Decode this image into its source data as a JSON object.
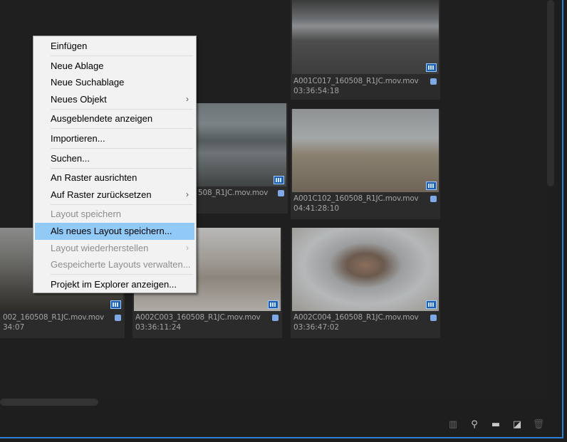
{
  "clips": [
    {
      "name": "A001C017_160508_R1JC.mov.mov",
      "timecode": "03:36:54:18"
    },
    {
      "name": "A001C102_160508_R1JC.mov.mov",
      "timecode": "04:41:28:10"
    },
    {
      "name": "508_R1JC.mov.mov",
      "timecode": ""
    },
    {
      "name": "002_160508_R1JC.mov.mov",
      "timecode": "34:07"
    },
    {
      "name": "A002C003_160508_R1JC.mov.mov",
      "timecode": "03:36:11:24"
    },
    {
      "name": "A002C004_160508_R1JC.mov.mov",
      "timecode": "03:36:47:02"
    }
  ],
  "menu": {
    "paste": "Einfügen",
    "new_bin": "Neue Ablage",
    "new_search_bin": "Neue Suchablage",
    "new_item": "Neues Objekt",
    "show_hidden": "Ausgeblendete anzeigen",
    "import": "Importieren...",
    "find": "Suchen...",
    "align_grid": "An Raster ausrichten",
    "reset_grid": "Auf Raster zurücksetzen",
    "save_layout": "Layout speichern",
    "save_new_layout": "Als neues Layout speichern...",
    "restore_layout": "Layout wiederherstellen",
    "manage_layouts": "Gespeicherte Layouts verwalten...",
    "reveal_explorer": "Projekt im Explorer anzeigen...",
    "submenu_arrow": "›"
  },
  "toolbar": {
    "icons": [
      "automate-sequence-icon",
      "search-icon",
      "new-bin-icon",
      "new-item-icon",
      "trash-icon"
    ]
  },
  "colors": {
    "accent": "#2d7fd6",
    "highlight": "#91c9f7",
    "badge": "#7ea9e6"
  }
}
